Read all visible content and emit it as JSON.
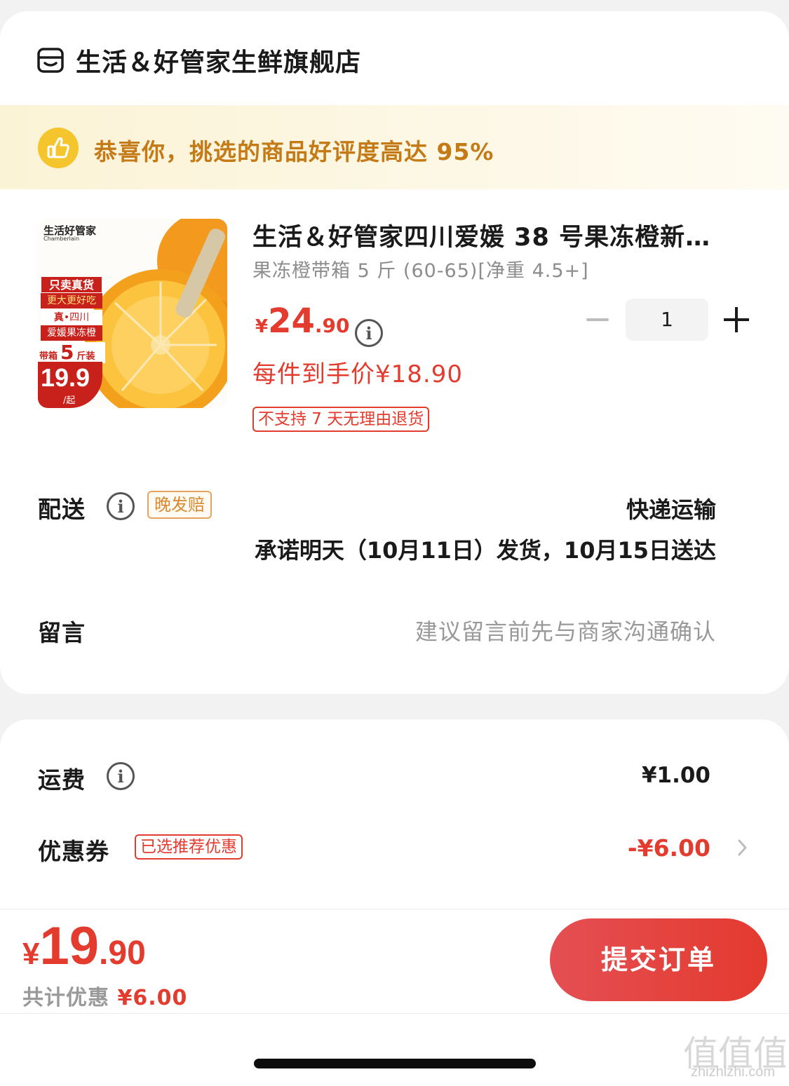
{
  "store": {
    "name": "生活＆好管家生鲜旗舰店",
    "icon": "store-icon"
  },
  "banner": {
    "text": "恭喜你，挑选的商品好评度高达 95%",
    "icon": "thumbs-up-icon"
  },
  "product": {
    "title": "生活＆好管家四川爱媛 38 号果冻橙新…",
    "spec": "果冻橙带箱 5 斤 (60-65)[净重 4.5+]",
    "price_currency": "¥",
    "price_int": "24",
    "price_dec": ".90",
    "quantity": "1",
    "unit_price": "每件到手价¥18.90",
    "return_policy": "不支持 7 天无理由退货",
    "image": {
      "brand": "生活好管家",
      "brand_en": "Chamberlain",
      "badge1": "只卖真货",
      "badge2": "更大更好吃",
      "badge3": "真",
      "badge4": "四川",
      "badge5": "爱媛果冻橙",
      "badge6": "带箱",
      "badge7": "5",
      "badge8": "斤装",
      "badge_price": "19.9",
      "badge_unit": "/起"
    }
  },
  "delivery": {
    "label": "配送",
    "tag": "晚发赔",
    "method": "快递运输",
    "promise": "承诺明天（10月11日）发货，10月15日送达"
  },
  "message": {
    "label": "留言",
    "placeholder": "建议留言前先与商家沟通确认"
  },
  "fees": {
    "shipping_label": "运费",
    "shipping_value": "¥1.00",
    "coupon_label": "优惠券",
    "coupon_tag": "已选推荐优惠",
    "coupon_value": "-¥6.00"
  },
  "footer": {
    "total_currency": "¥",
    "total_int": "19",
    "total_dec": ".90",
    "saved_label": "共计优惠",
    "saved_value": "¥6.00",
    "submit_label": "提交订单"
  },
  "watermark": {
    "logo": "值值值",
    "site": "zhizhizhi.com"
  },
  "colors": {
    "accent_red": "#e33b2e",
    "banner_text": "#c47a16",
    "banner_bg": "#fbf3d6",
    "tag_orange": "#d8892f"
  }
}
